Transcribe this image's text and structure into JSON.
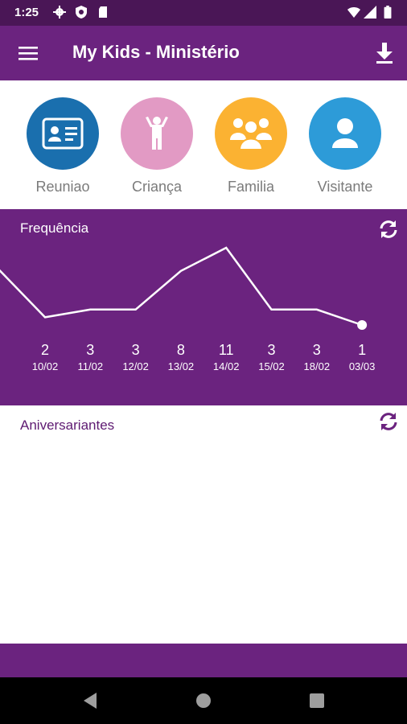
{
  "status_bar": {
    "time": "1:25",
    "icons": [
      "gear-icon",
      "shield-icon",
      "sd-card-icon",
      "wifi-icon",
      "signal-icon",
      "battery-icon"
    ]
  },
  "app_bar": {
    "title": "My Kids - Ministério",
    "menu_icon": "menu-icon",
    "download_icon": "download-icon"
  },
  "shortcuts": [
    {
      "label": "Reuniao",
      "icon": "id-card-icon",
      "color": "#1a6fae"
    },
    {
      "label": "Criança",
      "icon": "child-icon",
      "color": "#e29ac4"
    },
    {
      "label": "Familia",
      "icon": "group-icon",
      "color": "#fbb232"
    },
    {
      "label": "Visitante",
      "icon": "person-icon",
      "color": "#2d9bd8"
    }
  ],
  "frequency": {
    "title": "Frequência",
    "refresh_icon": "refresh-icon"
  },
  "chart_data": {
    "type": "line",
    "categories": [
      "10/02",
      "11/02",
      "12/02",
      "13/02",
      "14/02",
      "15/02",
      "18/02",
      "03/03"
    ],
    "values": [
      2,
      3,
      3,
      8,
      11,
      3,
      3,
      1
    ],
    "title": "Frequência",
    "xlabel": "",
    "ylabel": "",
    "grid": false,
    "line_color": "#ffffff",
    "background": "#6b237f"
  },
  "birthdays": {
    "title": "Aniversariantes",
    "refresh_icon": "refresh-icon"
  },
  "nav_bar": {
    "icons": [
      "back-icon",
      "home-icon",
      "recents-icon"
    ]
  },
  "colors": {
    "primary": "#6b237f",
    "status_bar": "#4a1656",
    "accent_text": "#5e1a72"
  }
}
